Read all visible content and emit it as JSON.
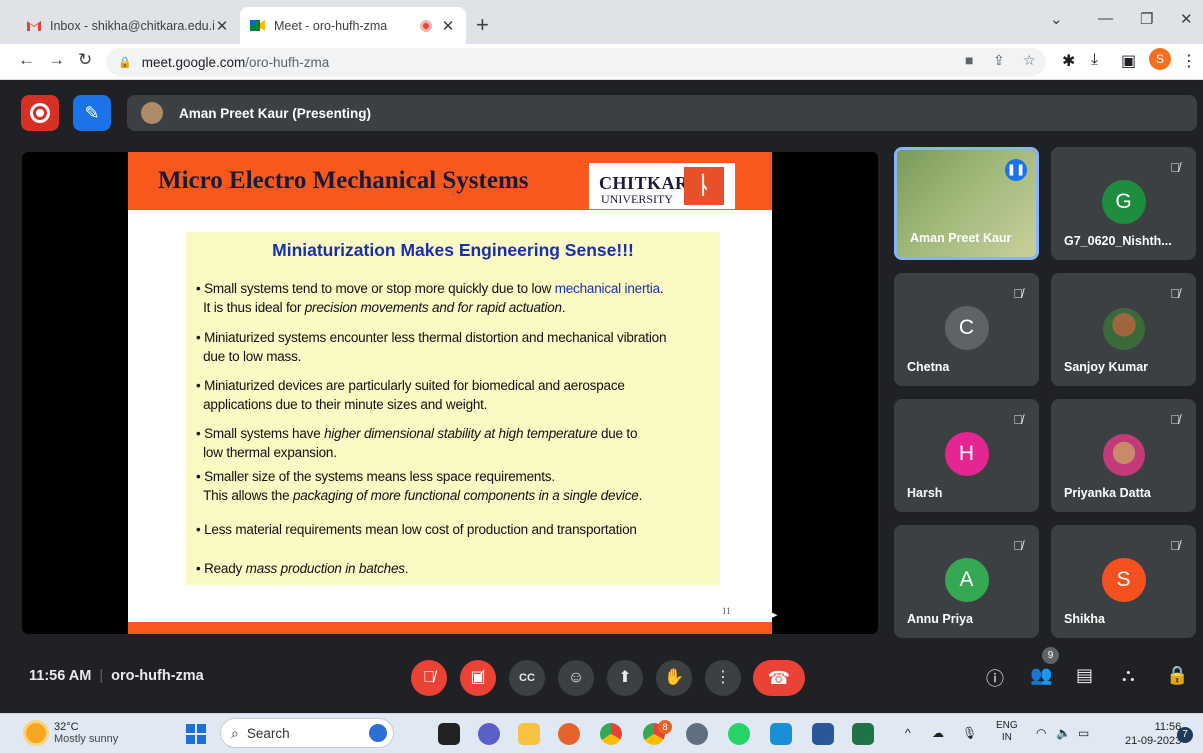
{
  "browser": {
    "tabs": [
      {
        "title": "Inbox - shikha@chitkara.edu.in -",
        "active": false,
        "favicon": "gmail-icon"
      },
      {
        "title": "Meet - oro-hufh-zma",
        "active": true,
        "favicon": "meet-icon"
      }
    ],
    "new_tab_label": "+",
    "url_host": "meet.google.com",
    "url_path": "/oro-hufh-zma",
    "profile_initial": "S"
  },
  "meet": {
    "presenter_label": "Aman Preet Kaur (Presenting)",
    "time": "11:56 AM",
    "meeting_code": "oro-hufh-zma",
    "participant_count_badge": "9",
    "participants": [
      {
        "name": "Aman Preet Kaur",
        "type": "video",
        "speaking": true
      },
      {
        "name": "G7_0620_Nishth...",
        "initial": "G",
        "color": "#1e8e3e",
        "muted": true
      },
      {
        "name": "Chetna",
        "initial": "C",
        "color": "#5f6368",
        "muted": true
      },
      {
        "name": "Sanjoy Kumar",
        "type": "photo",
        "muted": true
      },
      {
        "name": "Harsh",
        "initial": "H",
        "color": "#e52592",
        "muted": true
      },
      {
        "name": "Priyanka Datta",
        "type": "photo",
        "muted": true
      },
      {
        "name": "Annu Priya",
        "initial": "A",
        "color": "#34a853",
        "muted": true
      },
      {
        "name": "Shikha",
        "initial": "S",
        "color": "#f4511e",
        "muted": true
      }
    ]
  },
  "slide": {
    "title": "Micro Electro Mechanical Systems",
    "logo_text": "CHITKARA",
    "logo_sub": "UNIVERSITY",
    "heading": "Miniaturization Makes Engineering Sense!!!",
    "page_number": "11",
    "bullets": [
      {
        "lines": [
          "• Small systems tend to move or stop more quickly due to low ",
          "mechanical inertia",
          ".",
          "It is thus ideal for ",
          "precision movements and for rapid actuation",
          "."
        ]
      },
      {
        "line1": "• Miniaturized systems encounter less thermal distortion and mechanical vibration",
        "line2": "due to low mass."
      },
      {
        "line1": "• Miniaturized devices are particularly suited for biomedical and aerospace",
        "line2": "applications due to their minute sizes and weight."
      },
      {
        "a": "• Small systems have ",
        "b": "higher dimensional stability at high temperature",
        "c": " due to",
        "line2": "low thermal expansion."
      },
      {
        "line1": "• Smaller size of the systems means less space requirements.",
        "a": "This allows the ",
        "b": "packaging of more functional components in a single device",
        "c": "."
      },
      {
        "line1": "• Less material requirements mean low cost of production and transportation"
      },
      {
        "a": "• Ready ",
        "b": "mass production in batches",
        "c": "."
      }
    ]
  },
  "taskbar": {
    "temperature": "32°C",
    "weather": "Mostly sunny",
    "search_placeholder": "Search",
    "lang_top": "ENG",
    "lang_bottom": "IN",
    "time": "11:56",
    "date": "21-09-2023",
    "notification_count": "7",
    "chrome_badge": "8"
  }
}
